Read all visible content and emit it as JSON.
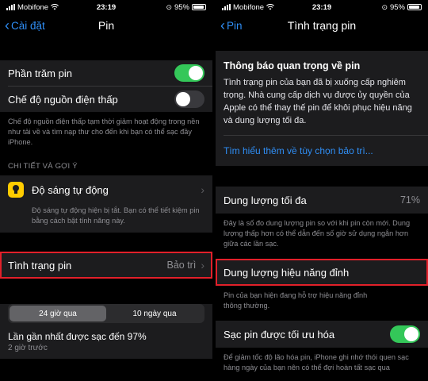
{
  "status": {
    "carrier": "Mobifone",
    "time": "23:19",
    "battery": "95%"
  },
  "left": {
    "back_label": "Cài đặt",
    "title": "Pin",
    "battery_percent_label": "Phần trăm pin",
    "battery_percent_on": true,
    "low_power_label": "Chế độ nguồn điện thấp",
    "low_power_on": false,
    "low_power_footer": "Chế độ nguồn điện thấp tạm thời giảm hoạt động trong nền như tải về và tìm nạp thư cho đến khi bạn có thể sạc đầy iPhone.",
    "section_header": "CHI TIẾT VÀ GỢI Ý",
    "auto_brightness_label": "Độ sáng tự động",
    "auto_brightness_footer": "Độ sáng tự động hiện bị tắt. Bạn có thể tiết kiệm pin bằng cách bật tính năng này.",
    "battery_health_label": "Tình trạng pin",
    "battery_health_value": "Bảo trì",
    "segment_24h": "24 giờ qua",
    "segment_10d": "10 ngày qua",
    "last_charged": "Lần gần nhất được sạc đến 97%",
    "last_charged_time": "2 giờ trước"
  },
  "right": {
    "back_label": "Pin",
    "title": "Tình trạng pin",
    "notice_title": "Thông báo quan trọng về pin",
    "notice_body": "Tình trạng pin của bạn đã bị xuống cấp nghiêm trọng. Nhà cung cấp dịch vụ được ủy quyền của Apple có thể thay thế pin để khôi phục hiệu năng và dung lượng tối đa.",
    "learn_more": "Tìm hiểu thêm về tùy chọn bảo trì...",
    "max_capacity_label": "Dung lượng tối đa",
    "max_capacity_value": "71%",
    "max_capacity_footer": "Đây là số đo dung lượng pin so với khi pin còn mới. Dung lượng thấp hơn có thể dẫn đến số giờ sử dụng ngắn hơn giữa các lần sạc.",
    "peak_perf_label": "Dung lượng hiệu năng đỉnh",
    "peak_perf_footer": "Pin của bạn hiện đang hỗ trợ hiệu năng đỉnh thông thường.",
    "optimized_label": "Sạc pin được tối ưu hóa",
    "optimized_on": true,
    "optimized_footer": "Để giảm tốc độ lão hóa pin, iPhone ghi nhớ thói quen sạc hàng ngày của bạn nên có thể đợi hoàn tất sạc qua"
  }
}
